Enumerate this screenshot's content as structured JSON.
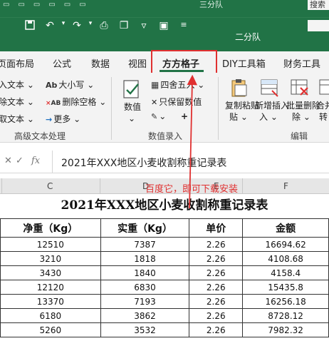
{
  "back_window": {
    "title": "三分队",
    "search_label": "搜索"
  },
  "window": {
    "title": "二分队",
    "qat_icons": [
      "save-icon",
      "undo-icon",
      "redo-icon",
      "print-icon",
      "clipboard-icon",
      "filter-icon",
      "box-icon",
      "customize-icon"
    ]
  },
  "tabs": [
    {
      "label": "页面布局"
    },
    {
      "label": "公式"
    },
    {
      "label": "数据"
    },
    {
      "label": "视图"
    },
    {
      "label": "方方格子"
    },
    {
      "label": "DIY工具箱"
    },
    {
      "label": "财务工具"
    }
  ],
  "ribbon": {
    "text_group": {
      "items": [
        "入文本",
        "除文本",
        "取文本"
      ],
      "case_label": "大小写",
      "case_icon_text": "Ab",
      "delete_space_label": "删除空格",
      "delete_space_icon_text": "AB",
      "more_label": "更多",
      "group_label": "高级文本处理"
    },
    "number_group": {
      "big_label": "数值",
      "round_label": "四舍五入",
      "keep_label": "只保留数值",
      "plus": "+",
      "group_label": "数值录入"
    },
    "edit_group": {
      "copy_paste_label": "复制粘贴",
      "copy_paste_sub": "贴",
      "insert_label": "新增插入",
      "insert_sub": "入",
      "batch_delete_label": "批量删除",
      "batch_delete_sub": "除",
      "merge_label": "合并",
      "merge_sub": "转",
      "group_label": "编辑"
    }
  },
  "formula_bar": {
    "cancel": "✕",
    "confirm": "✓",
    "fx": "fx",
    "content": "2021年XXX地区小麦收割称重记录表"
  },
  "column_headers": [
    "C",
    "D",
    "E",
    "F"
  ],
  "annotation": {
    "text": "百度它，即可下载安装",
    "color": "#e03030"
  },
  "sheet": {
    "title": "2021年XXX地区小麦收割称重记录表",
    "headers": [
      "净重（Kg）",
      "实重（Kg）",
      "单价",
      "金额"
    ],
    "rows": [
      [
        "12510",
        "7387",
        "2.26",
        "16694.62"
      ],
      [
        "3210",
        "1818",
        "2.26",
        "4108.68"
      ],
      [
        "3430",
        "1840",
        "2.26",
        "4158.4"
      ],
      [
        "12120",
        "6830",
        "2.26",
        "15435.8"
      ],
      [
        "13370",
        "7193",
        "2.26",
        "16256.18"
      ],
      [
        "6180",
        "3862",
        "2.26",
        "8728.12"
      ],
      [
        "5260",
        "3532",
        "2.26",
        "7982.32"
      ]
    ]
  },
  "colors": {
    "excel_green": "#217346",
    "ribbon_bg": "#f3f3f3",
    "annotation_red": "#e03030"
  }
}
